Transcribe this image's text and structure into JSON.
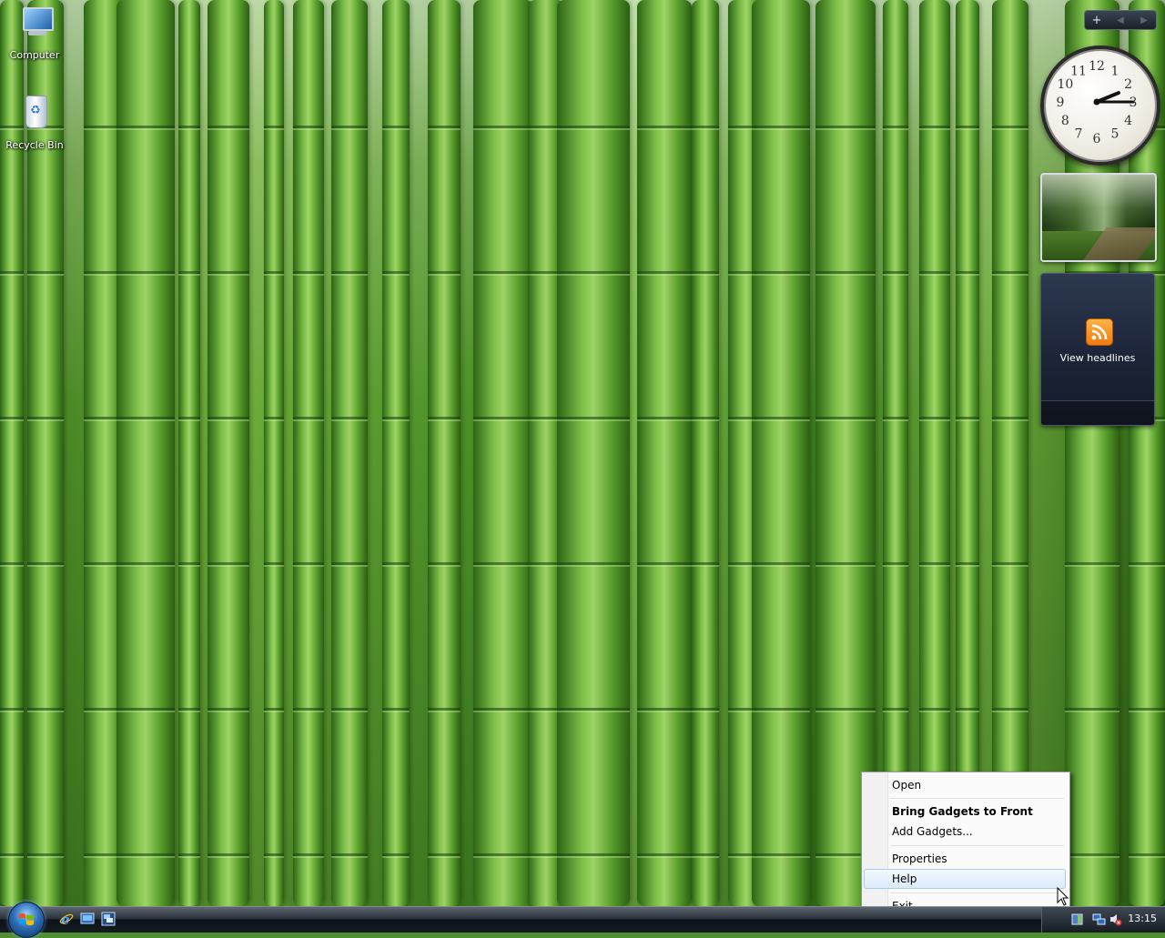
{
  "desktop": {
    "icons": [
      {
        "label": "Computer",
        "icon": "computer-icon"
      },
      {
        "label": "Recycle Bin",
        "icon": "recycle-bin-icon"
      }
    ]
  },
  "sidebar": {
    "add_gadget": "+",
    "prev": "◀",
    "next": "▶"
  },
  "gadgets": {
    "clock": {
      "time": "2:15",
      "numbers": [
        "12",
        "1",
        "2",
        "3",
        "4",
        "5",
        "6",
        "7",
        "8",
        "9",
        "10",
        "11"
      ]
    },
    "slideshow": {
      "icon": "forest-photo"
    },
    "feeds": {
      "label": "View headlines",
      "icon": "rss-icon"
    }
  },
  "context_menu": {
    "items": [
      {
        "label": "Open",
        "bold": false
      },
      {
        "label": "Bring Gadgets to Front",
        "bold": true
      },
      {
        "label": "Add Gadgets...",
        "bold": false
      },
      {
        "label": "Properties",
        "bold": false
      },
      {
        "label": "Help",
        "bold": false,
        "highlighted": true
      },
      {
        "label": "Exit",
        "bold": false
      }
    ]
  },
  "taskbar": {
    "start": "start-orb",
    "quick_launch": [
      "internet-explorer-icon",
      "show-desktop-icon",
      "switch-windows-icon"
    ],
    "tray_icons": [
      "sidebar-tray-icon",
      "network-icon",
      "volume-muted-icon"
    ],
    "clock": "13:15"
  },
  "colors": {
    "menu_highlight": "#dcebfa",
    "taskbar": "#141b22"
  }
}
